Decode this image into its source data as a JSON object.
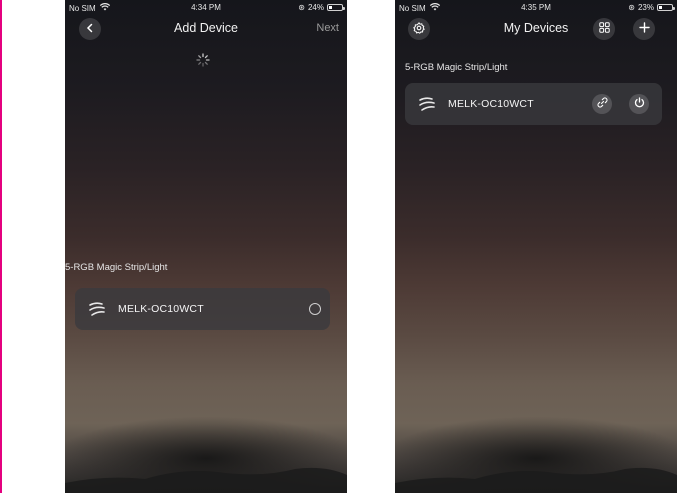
{
  "left": {
    "status": {
      "carrier": "No SIM",
      "time": "4:34 PM",
      "battery": "24%",
      "battery_level": 0.24
    },
    "nav": {
      "back_icon": "chevron-left-icon",
      "title": "Add Device",
      "next_label": "Next"
    },
    "section_label": "5-RGB Magic Strip/Light",
    "device": {
      "name": "MELK-OC10WCT",
      "icon": "light-strip-icon",
      "select_icon": "radio-unselected-icon"
    }
  },
  "right": {
    "status": {
      "carrier": "No SIM",
      "time": "4:35 PM",
      "battery": "23%",
      "battery_level": 0.23
    },
    "nav": {
      "settings_icon": "gear-icon",
      "title": "My Devices",
      "grid_icon": "grid-icon",
      "add_icon": "plus-icon"
    },
    "section_label": "5-RGB Magic Strip/Light",
    "device": {
      "name": "MELK-OC10WCT",
      "icon": "light-strip-icon",
      "link_icon": "link-icon",
      "power_icon": "power-icon"
    }
  }
}
